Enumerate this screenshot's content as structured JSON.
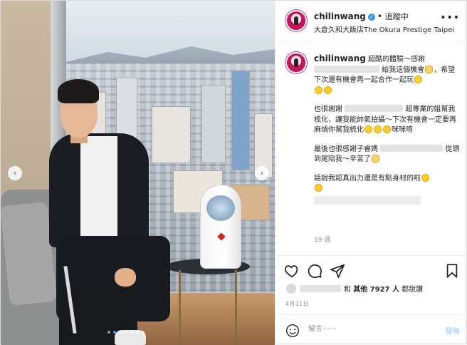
{
  "account": {
    "username": "chilinwang",
    "verified_mark": "✓",
    "separator": "•",
    "follow_label": "追蹤中",
    "location": "大倉久和大飯店The Okura Prestige Taipei",
    "more_glyph": "•••"
  },
  "caption": {
    "username": "chilinwang",
    "p1": [
      "超酷的體驗～感謝",
      "給我這個機會",
      "，希望下次還有機會再一起合作一起玩"
    ],
    "p2": [
      "也很謝謝",
      "超專業的姐幫我梳化，讓我能帥氣拍攝～下次有機會一定要再麻煩你幫我梳化",
      "咪咪唷"
    ],
    "p3": [
      "最後也很感謝子睿媽",
      "從頭到尾陪我～辛苦了"
    ],
    "p4": [
      "話說我認真出力還是有點身材的啦"
    ],
    "comment_time": "19 週"
  },
  "likes": {
    "prefix": "和",
    "others": "其他 7927 人",
    "suffix": "都說讚"
  },
  "post_date": "4月11日",
  "comment_box": {
    "placeholder": "留言⋯⋯",
    "post_label": "發佈"
  },
  "carousel": {
    "prev_glyph": "‹",
    "next_glyph": "›",
    "dot_count": 7,
    "active_dot": 1
  },
  "colors": {
    "accent": "#3897f0",
    "verified": "#3897f0",
    "post_button_disabled": "#b3dbff"
  },
  "icons": [
    "heart-icon",
    "comment-icon",
    "share-icon",
    "bookmark-icon",
    "smile-icon",
    "chevron-left-icon",
    "chevron-right-icon",
    "verified-icon"
  ]
}
